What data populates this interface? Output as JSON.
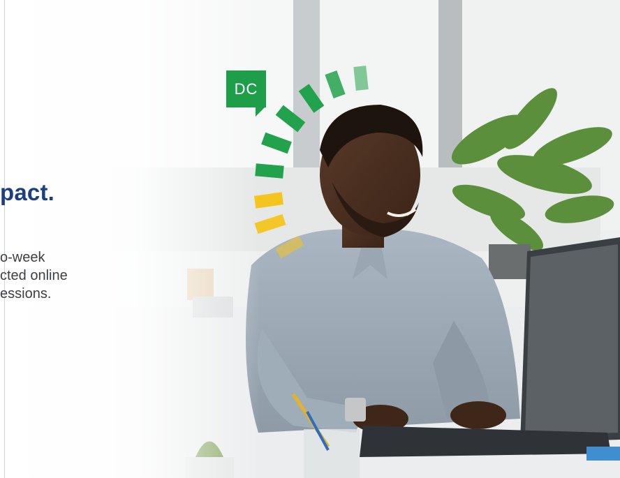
{
  "headline": "pact.",
  "body_lines": [
    "o-week",
    "cted online",
    "essions."
  ],
  "badge": {
    "label": "DC",
    "color": "#1f9e4a"
  },
  "meter_colors": {
    "green": "#22a24c",
    "yellow": "#f3c51e"
  }
}
